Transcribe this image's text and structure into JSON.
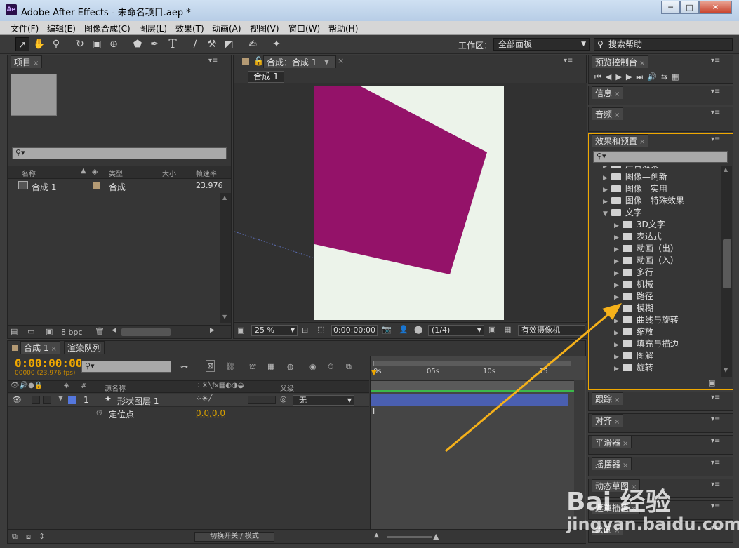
{
  "window": {
    "title": "Adobe After Effects - 未命名项目.aep *",
    "app_badge": "Ae",
    "minimize": "─",
    "maximize": "□",
    "close": "✕"
  },
  "menu": [
    "文件(F)",
    "编辑(E)",
    "图像合成(C)",
    "图层(L)",
    "效果(T)",
    "动画(A)",
    "视图(V)",
    "窗口(W)",
    "帮助(H)"
  ],
  "toolbar": {
    "workspace_label": "工作区：",
    "workspace_value": "全部面板",
    "search_placeholder": "搜索帮助"
  },
  "project": {
    "tab": "项目",
    "columns": [
      "名称",
      "类型",
      "大小",
      "帧速率"
    ],
    "items": [
      {
        "name": "合成 1",
        "type": "合成",
        "fps": "23.976"
      }
    ],
    "bpc": "8 bpc"
  },
  "composition": {
    "tab": "合成：合成 1",
    "comp_button": "合成 1",
    "zoom": "25 %",
    "timecode": "0:00:00:00",
    "resolution": "(1/4)",
    "camera": "有效摄像机"
  },
  "timeline": {
    "tabs": [
      "合成 1",
      "渲染队列"
    ],
    "timecode": "0:00:00:00",
    "fps_text": "00000 (23.976 fps)",
    "col_source": "源名称",
    "col_parent": "父级",
    "ruler": [
      "0s",
      "05s",
      "10s",
      "15"
    ],
    "layers": [
      {
        "num": "1",
        "name": "形状图层 1",
        "parent": "无"
      }
    ],
    "property": {
      "name": "定位点",
      "value": "0.0,0.0"
    },
    "toggle_label": "切换开关 / 模式"
  },
  "right_panels": {
    "preview": "预览控制台",
    "info": "信息",
    "audio": "音频",
    "effects": "效果和预置",
    "tracker": "跟踪",
    "align": "对齐",
    "smoother": "平滑器",
    "wiggler": "摇摆器",
    "motion_sketch": "动态草图",
    "mask_interp": "遮罩插值",
    "paint": "绘画"
  },
  "effects_tree": [
    {
      "label": "声音效果",
      "level": 1,
      "open": false
    },
    {
      "label": "图像—创新",
      "level": 1,
      "open": false
    },
    {
      "label": "图像—实用",
      "level": 1,
      "open": false
    },
    {
      "label": "图像—特殊效果",
      "level": 1,
      "open": false
    },
    {
      "label": "文字",
      "level": 1,
      "open": true
    },
    {
      "label": "3D文字",
      "level": 2,
      "open": false
    },
    {
      "label": "表达式",
      "level": 2,
      "open": false
    },
    {
      "label": "动画（出）",
      "level": 2,
      "open": false
    },
    {
      "label": "动画（入）",
      "level": 2,
      "open": false
    },
    {
      "label": "多行",
      "level": 2,
      "open": false
    },
    {
      "label": "机械",
      "level": 2,
      "open": false
    },
    {
      "label": "路径",
      "level": 2,
      "open": false
    },
    {
      "label": "模糊",
      "level": 2,
      "open": false
    },
    {
      "label": "曲线与旋转",
      "level": 2,
      "open": false
    },
    {
      "label": "缩放",
      "level": 2,
      "open": false
    },
    {
      "label": "填充与描边",
      "level": 2,
      "open": false
    },
    {
      "label": "图解",
      "level": 2,
      "open": false
    },
    {
      "label": "旋转",
      "level": 2,
      "open": false
    }
  ],
  "watermark": {
    "line1": "Bai 经验",
    "line2": "jingyan.baidu.com"
  },
  "colors": {
    "accent": "#f0a800",
    "shape": "#941269",
    "canvas": "#ecf3ea",
    "layer_bar": "#4a5fb0",
    "timecode": "#f0a800",
    "playhead": "#e03030",
    "arrow": "#f5b11a"
  }
}
